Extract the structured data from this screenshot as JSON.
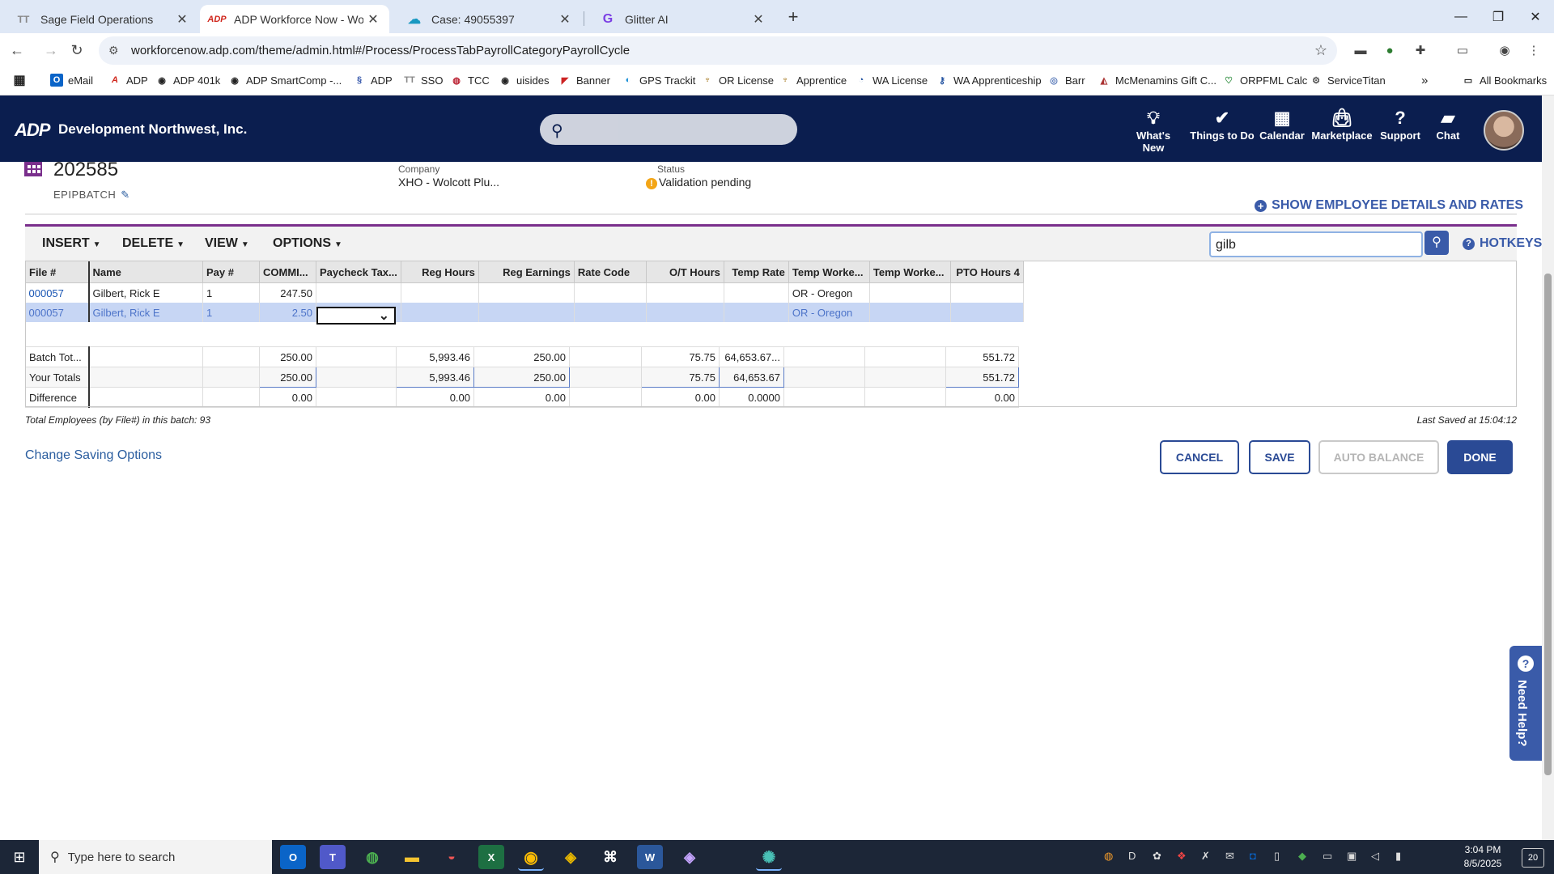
{
  "browser": {
    "tabs": [
      {
        "label": "Sage Field Operations",
        "icon": "tt-icon",
        "icon_text": "TT"
      },
      {
        "label": "ADP Workforce Now - Workshe",
        "icon": "adp-icon",
        "icon_text": "ADP"
      },
      {
        "label": "Case: 49055397",
        "icon": "salesforce-icon",
        "icon_text": "☁"
      },
      {
        "label": "Glitter AI",
        "icon": "glitter-icon",
        "icon_text": "G"
      }
    ],
    "url": "workforcenow.adp.com/theme/admin.html#/Process/ProcessTabPayrollCategoryPayrollCycle",
    "bookmarks": [
      "eMail",
      "ADP",
      "ADP 401k",
      "ADP SmartComp -...",
      "ADP",
      "SSO",
      "TCC",
      "uisides",
      "Banner",
      "GPS Trackit",
      "OR License",
      "Apprentice",
      "WA License",
      "WA Apprenticeship",
      "Barr",
      "McMenamins Gift C...",
      "ORPFML Calc",
      "ServiceTitan"
    ],
    "all_bookmarks": "All Bookmarks"
  },
  "header": {
    "logo": "ADP",
    "company": "Development Northwest, Inc.",
    "nav": [
      "What's New",
      "Things to Do",
      "Calendar",
      "Marketplace",
      "Support",
      "Chat"
    ]
  },
  "batch": {
    "title": "202585",
    "subtitle": "EPIPBATCH",
    "company_label": "Company",
    "company_value": "XHO - Wolcott Plu...",
    "status_label": "Status",
    "status_value": "Validation pending",
    "show_details": "SHOW EMPLOYEE DETAILS AND RATES"
  },
  "toolbar": {
    "menus": [
      "INSERT",
      "DELETE",
      "VIEW",
      "OPTIONS"
    ],
    "search_value": "gilb",
    "hotkeys": "HOTKEYS"
  },
  "grid": {
    "columns": [
      "File #",
      "Name",
      "Pay #",
      "COMMI...",
      "Paycheck Tax...",
      "Reg Hours",
      "Reg Earnings",
      "Rate Code",
      "O/T Hours",
      "Temp Rate",
      "Temp Worke...",
      "Temp Worke...",
      "PTO Hours 4"
    ],
    "rows": [
      [
        "000057",
        "Gilbert, Rick E",
        "1",
        "247.50",
        "",
        "",
        "",
        "",
        "",
        "",
        "OR - Oregon",
        "",
        ""
      ],
      [
        "000057",
        "Gilbert, Rick E",
        "1",
        "2.50",
        "",
        "",
        "",
        "",
        "",
        "",
        "OR - Oregon",
        "",
        ""
      ]
    ],
    "totals": [
      [
        "Batch Tot...",
        "",
        "",
        "250.00",
        "",
        "5,993.46",
        "250.00",
        "",
        "75.75",
        "64,653.67...",
        "",
        "",
        "551.72"
      ],
      [
        "Your Totals",
        "",
        "",
        "250.00",
        "",
        "5,993.46",
        "250.00",
        "",
        "75.75",
        "64,653.67",
        "",
        "",
        "551.72"
      ],
      [
        "Difference",
        "",
        "",
        "0.00",
        "",
        "0.00",
        "0.00",
        "",
        "0.00",
        "0.0000",
        "",
        "",
        "0.00"
      ]
    ]
  },
  "footer": {
    "employee_count": "Total Employees (by File#) in this batch: 93",
    "last_saved": "Last Saved at 15:04:12",
    "change_saving": "Change Saving Options",
    "cancel": "CANCEL",
    "save": "SAVE",
    "auto_balance": "AUTO BALANCE",
    "done": "DONE"
  },
  "need_help": "Need Help?",
  "taskbar": {
    "search_placeholder": "Type here to search",
    "time": "3:04 PM",
    "date": "8/5/2025",
    "notifications": "20"
  }
}
